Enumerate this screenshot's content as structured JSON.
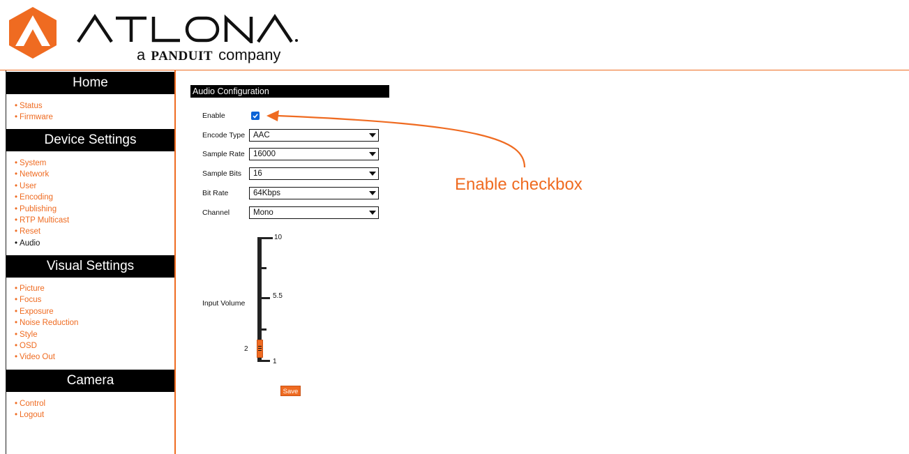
{
  "brand": {
    "name": "ATLONA",
    "tagline_pre": "a",
    "tagline_brand": "PANDUIT",
    "tagline_post": "company",
    "accent_color": "#ef6b21"
  },
  "sidebar": {
    "home": {
      "heading": "Home",
      "items": [
        {
          "label": "Status"
        },
        {
          "label": "Firmware"
        }
      ]
    },
    "device_settings": {
      "heading": "Device Settings",
      "items": [
        {
          "label": "System"
        },
        {
          "label": "Network"
        },
        {
          "label": "User"
        },
        {
          "label": "Encoding"
        },
        {
          "label": "Publishing"
        },
        {
          "label": "RTP Multicast"
        },
        {
          "label": "Reset"
        },
        {
          "label": "Audio",
          "current": true
        }
      ]
    },
    "visual_settings": {
      "heading": "Visual Settings",
      "items": [
        {
          "label": "Picture"
        },
        {
          "label": "Focus"
        },
        {
          "label": "Exposure"
        },
        {
          "label": "Noise Reduction"
        },
        {
          "label": "Style"
        },
        {
          "label": "OSD"
        },
        {
          "label": "Video Out"
        }
      ]
    },
    "camera": {
      "heading": "Camera",
      "items": [
        {
          "label": "Control"
        },
        {
          "label": "Logout"
        }
      ]
    }
  },
  "main": {
    "title": "Audio Configuration",
    "enable": {
      "label": "Enable",
      "checked": true
    },
    "encode_type": {
      "label": "Encode Type",
      "value": "AAC"
    },
    "sample_rate": {
      "label": "Sample Rate",
      "value": "16000"
    },
    "sample_bits": {
      "label": "Sample Bits",
      "value": "16"
    },
    "bit_rate": {
      "label": "Bit Rate",
      "value": "64Kbps"
    },
    "channel": {
      "label": "Channel",
      "value": "Mono"
    },
    "input_volume": {
      "label": "Input Volume",
      "value": "2",
      "min": "1",
      "mid": "5.5",
      "max": "10"
    },
    "save_label": "Save"
  },
  "annotation": {
    "text": "Enable checkbox"
  }
}
